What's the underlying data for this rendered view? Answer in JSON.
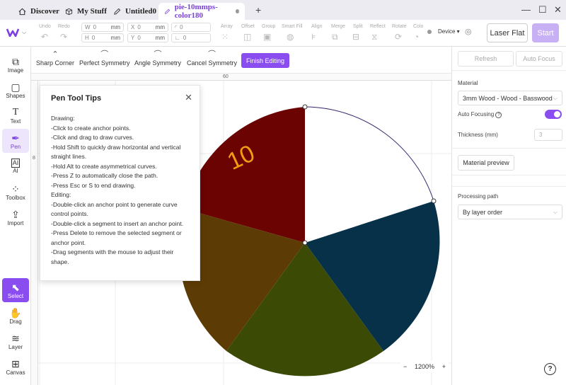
{
  "tabs": [
    {
      "label": "Discover",
      "icon": "home-icon"
    },
    {
      "label": "My Stuff",
      "icon": "box-icon"
    },
    {
      "label": "Untitled0",
      "icon": "pencil-icon"
    },
    {
      "label": "pie-10mmps-color180",
      "icon": "pencil-icon"
    }
  ],
  "new_tab": "+",
  "window": {
    "minimize": "—",
    "maximize": "☐",
    "close": "✕"
  },
  "toolbar": {
    "undo": "Undo",
    "redo": "Redo",
    "w_label": "W",
    "w_value": "0",
    "h_label": "H",
    "h_value": "0",
    "unit": "mm",
    "x_label": "X",
    "x_value": "0",
    "y_label": "Y",
    "y_value": "0",
    "rot_value": "0",
    "array": "Array",
    "offset": "Offset",
    "group": "Group",
    "smart_fill": "Smart Fill",
    "align": "Align",
    "merge": "Merge",
    "split": "Split",
    "reflect": "Reflect",
    "rotate": "Rotate",
    "color": "Colo",
    "device": "Device",
    "laser_flat": "Laser Flat",
    "start": "Start"
  },
  "sidebar": [
    {
      "label": "Image",
      "icon": "image-icon"
    },
    {
      "label": "Shapes",
      "icon": "shapes-icon"
    },
    {
      "label": "Text",
      "icon": "text-icon"
    },
    {
      "label": "Pen",
      "icon": "pen-icon"
    },
    {
      "label": "AI",
      "icon": "ai-icon"
    },
    {
      "label": "Toolbox",
      "icon": "toolbox-icon"
    },
    {
      "label": "Import",
      "icon": "import-icon"
    },
    {
      "label": "Select",
      "icon": "cursor-icon"
    },
    {
      "label": "Drag",
      "icon": "hand-icon"
    },
    {
      "label": "Layer",
      "icon": "layers-icon"
    },
    {
      "label": "Canvas",
      "icon": "canvas-icon"
    }
  ],
  "pen_tools": {
    "sharp_corner": "Sharp Corner",
    "perfect_symmetry": "Perfect Symmetry",
    "angle_symmetry": "Angle Symmetry",
    "cancel_symmetry": "Cancel Symmetry",
    "finish_editing": "Finish Editing"
  },
  "ruler": {
    "top_mark": "60",
    "left_mark": "8"
  },
  "canvas": {
    "label_text": "10",
    "slice_colors": [
      "#6b0303",
      "#073049",
      "#3b4a05",
      "#5d3b04",
      "#ffffff"
    ],
    "outline_color": "#3a2670",
    "label_color": "#f39c12"
  },
  "tips": {
    "title": "Pen Tool Tips",
    "lines": [
      "Drawing:",
      "-Click to create anchor points.",
      "-Click and drag to draw curves.",
      "-Hold Shift to quickly draw horizontal and vertical straight lines.",
      "-Hold Alt to create asymmetrical curves.",
      "-Press Z to automatically close the path.",
      "-Press Esc or S to end drawing.",
      "Editing:",
      "-Double-click an anchor point to generate curve control points.",
      "-Double-click a segment to insert an anchor point.",
      "-Press Delete to remove the selected segment or anchor point.",
      "-Drag segments with the mouse to adjust their shape."
    ]
  },
  "zoom": {
    "minus": "−",
    "value": "1200%",
    "plus": "+"
  },
  "right_panel": {
    "refresh": "Refresh",
    "auto_focus_btn": "Auto Focus",
    "material_label": "Material",
    "material_value": "3mm Wood - Wood - Basswood",
    "auto_focusing_label": "Auto Focusing",
    "auto_focusing_on": true,
    "thickness_label": "Thickness (mm)",
    "thickness_value": "3",
    "material_preview": "Material preview",
    "processing_path_label": "Processing path",
    "processing_path_value": "By layer order"
  },
  "help": "?"
}
